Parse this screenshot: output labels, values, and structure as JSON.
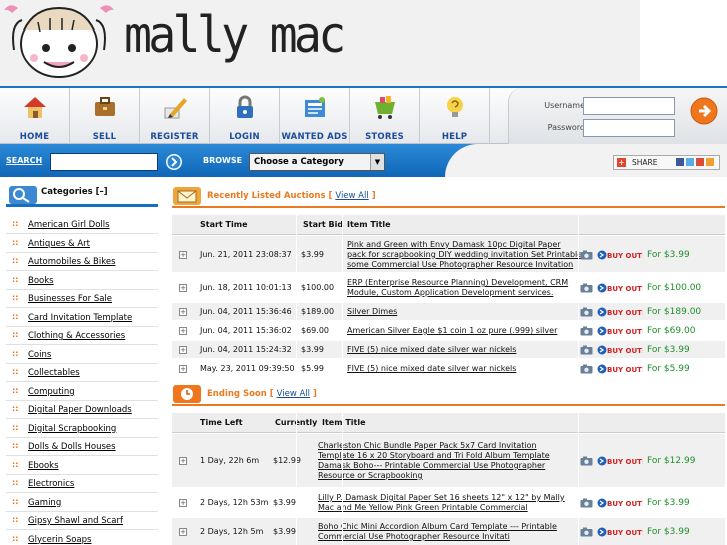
{
  "site": {
    "logo_text": "mally mac"
  },
  "nav": {
    "items": [
      {
        "label": "HOME",
        "icon": "home-icon"
      },
      {
        "label": "SELL",
        "icon": "briefcase-icon"
      },
      {
        "label": "REGISTER",
        "icon": "pencil-icon"
      },
      {
        "label": "LOGIN",
        "icon": "lock-icon"
      },
      {
        "label": "WANTED ADS",
        "icon": "wanted-ads-icon"
      },
      {
        "label": "STORES",
        "icon": "stores-icon"
      },
      {
        "label": "HELP",
        "icon": "help-icon"
      }
    ],
    "username_label": "Username",
    "password_label": "Password",
    "username_value": "",
    "password_value": ""
  },
  "search": {
    "label": "SEARCH",
    "value": "",
    "browse_label": "BROWSE",
    "category_selected": "Choose a Category",
    "share_label": "SHARE"
  },
  "sidebar": {
    "heading": "Categories [–]",
    "categories": [
      "American Girl Dolls",
      "Antiques & Art",
      "Automobiles & Bikes",
      "Books",
      "Businesses For Sale",
      "Card Invitation Template",
      "Clothing & Accessories",
      "Coins",
      "Collectables",
      "Computing",
      "Digital Paper Downloads",
      "Digital Scrapbooking",
      "Dolls & Dolls Houses",
      "Ebooks",
      "Electronics",
      "Gaming",
      "Gipsy Shawl and Scarf",
      "Glycerin Soaps"
    ]
  },
  "recent": {
    "title": "Recently Listed Auctions",
    "view_all": "View All",
    "headers": [
      "Start Time",
      "Start Bid",
      "Item Title"
    ],
    "rows": [
      {
        "time": "Jun. 21, 2011 23:08:37",
        "bid": "$3.99",
        "title_lines": [
          "Pink and Green with Envy Damask 10pc Digital Paper",
          "pack for scrapbooking DIY wedding invitation Set Printable",
          "some Commercial Use Photographer Resource Invitation"
        ],
        "price": "For $3.99"
      },
      {
        "time": "Jun. 18, 2011 10:01:13",
        "bid": "$100.00",
        "title_lines": [
          "ERP (Enterprise Resource Planning) Development, CRM",
          "Module, Custom Application Development services."
        ],
        "price": "For $100.00"
      },
      {
        "time": "Jun. 04, 2011 15:36:46",
        "bid": "$189.00",
        "title_lines": [
          "Silver Dimes"
        ],
        "price": "For $189.00"
      },
      {
        "time": "Jun. 04, 2011 15:36:02",
        "bid": "$69.00",
        "title_lines": [
          "American Silver Eagle $1 coin 1 oz pure (.999) silver"
        ],
        "price": "For $69.00"
      },
      {
        "time": "Jun. 04, 2011 15:24:32",
        "bid": "$3.99",
        "title_lines": [
          "FIVE (5) nice mixed date silver war nickels"
        ],
        "price": "For $3.99"
      },
      {
        "time": "May. 23, 2011 09:39:50",
        "bid": "$5.99",
        "title_lines": [
          "FIVE (5) nice mixed date silver war nickels"
        ],
        "price": "For $5.99"
      }
    ]
  },
  "ending": {
    "title": "Ending Soon",
    "view_all": "View All",
    "headers": [
      "Time Left",
      "Currently",
      "Item Title"
    ],
    "rows": [
      {
        "time": "1 Day, 22h 6m",
        "bid": "$12.99",
        "title_lines": [
          "Charleston Chic Bundle Paper Pack 5x7 Card Invitation",
          "Template 16 x 20 Storyboard and Tri Fold Album Template",
          "Damask Boho--- Printable Commercial Use Photographer",
          "Resource or Scrapbooking"
        ],
        "price": "For $12.99"
      },
      {
        "time": "2 Days, 12h 53m",
        "bid": "$3.99",
        "title_lines": [
          "Lilly P. Damask Digital Paper Set 16 sheets 12\" x 12\" by Mally",
          "Mac and Me Yellow Pink Green Printable Commercial"
        ],
        "price": "For $3.99"
      },
      {
        "time": "2 Days, 12h 5m",
        "bid": "$3.99",
        "title_lines": [
          "Boho Chic Mini Accordion Album Card Template --- Printable",
          "Commercial Use Photographer Resource Invitati"
        ],
        "price": "For $3.99"
      }
    ]
  },
  "actions": {
    "buy_now_label": "BUY OUT!"
  },
  "colors": {
    "accent_blue": "#1570c4",
    "accent_orange": "#e97a1f",
    "price_green": "#1f8f2a"
  }
}
